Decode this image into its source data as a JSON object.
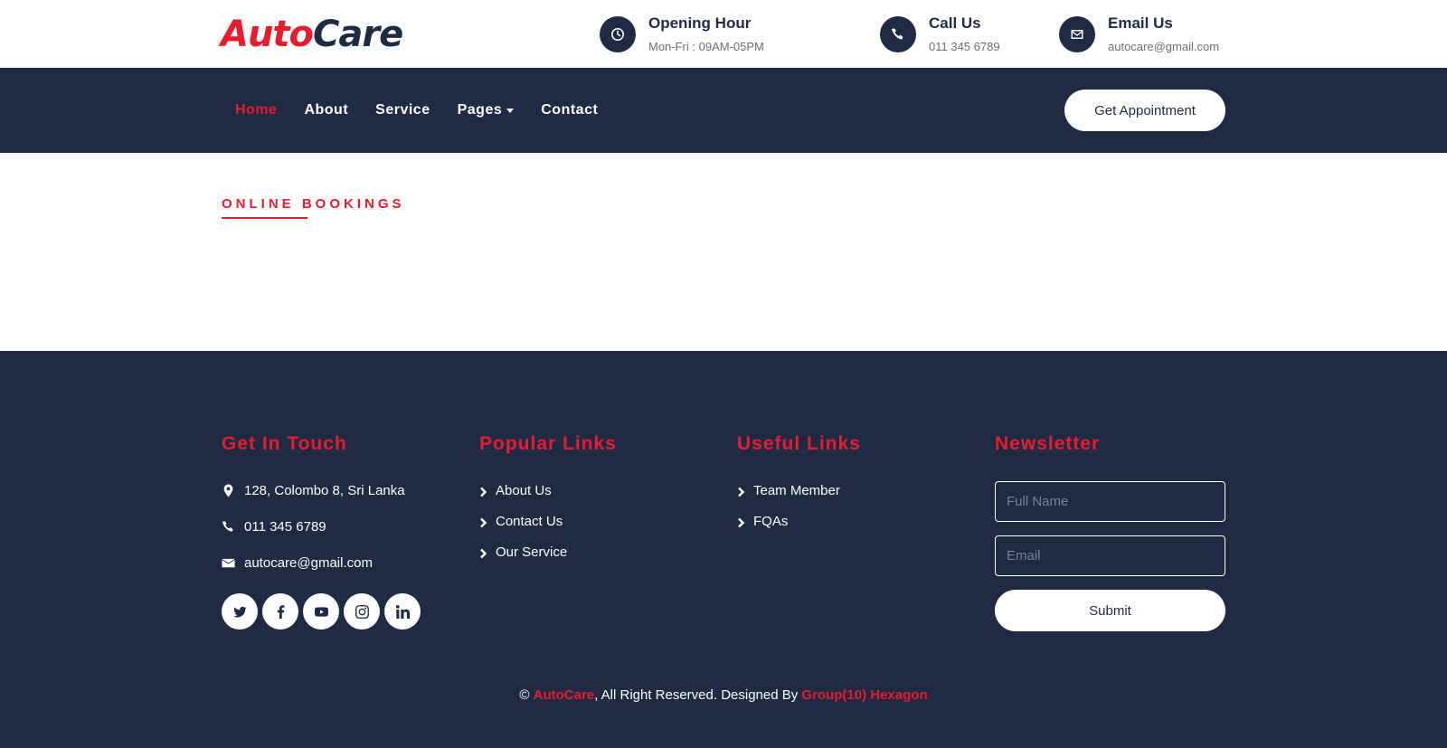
{
  "brand": {
    "part1": "Auto",
    "part2": "Care"
  },
  "header_info": [
    {
      "icon": "clock-icon",
      "title": "Opening Hour",
      "sub": "Mon-Fri : 09AM-05PM"
    },
    {
      "icon": "phone-icon",
      "title": "Call Us",
      "sub": "011 345 6789"
    },
    {
      "icon": "envelope-icon",
      "title": "Email Us",
      "sub": "autocare@gmail.com"
    }
  ],
  "nav": {
    "items": [
      "Home",
      "About",
      "Service",
      "Pages",
      "Contact"
    ],
    "active": "Home",
    "cta": "Get Appointment"
  },
  "section": {
    "title": "ONLINE BOOKINGS"
  },
  "footer": {
    "get_in_touch": {
      "heading": "Get In Touch",
      "address": "128, Colombo 8, Sri Lanka",
      "phone": "011 345 6789",
      "email": "autocare@gmail.com",
      "socials": [
        "twitter-icon",
        "facebook-icon",
        "youtube-icon",
        "instagram-icon",
        "linkedin-icon"
      ]
    },
    "popular_links": {
      "heading": "Popular Links",
      "links": [
        "About Us",
        "Contact Us",
        "Our Service"
      ]
    },
    "useful_links": {
      "heading": "Useful Links",
      "links": [
        "Team Member",
        "FQAs"
      ]
    },
    "newsletter": {
      "heading": "Newsletter",
      "name_placeholder": "Full Name",
      "email_placeholder": "Email",
      "submit": "Submit"
    },
    "copyright": {
      "symbol": "©",
      "brand": "AutoCare",
      "text": ", All Right Reserved. Designed By ",
      "designer": "Group(10) Hexagon"
    }
  },
  "colors": {
    "navy": "#1f2b45",
    "accent": "#e81c2e",
    "white": "#ffffff"
  }
}
